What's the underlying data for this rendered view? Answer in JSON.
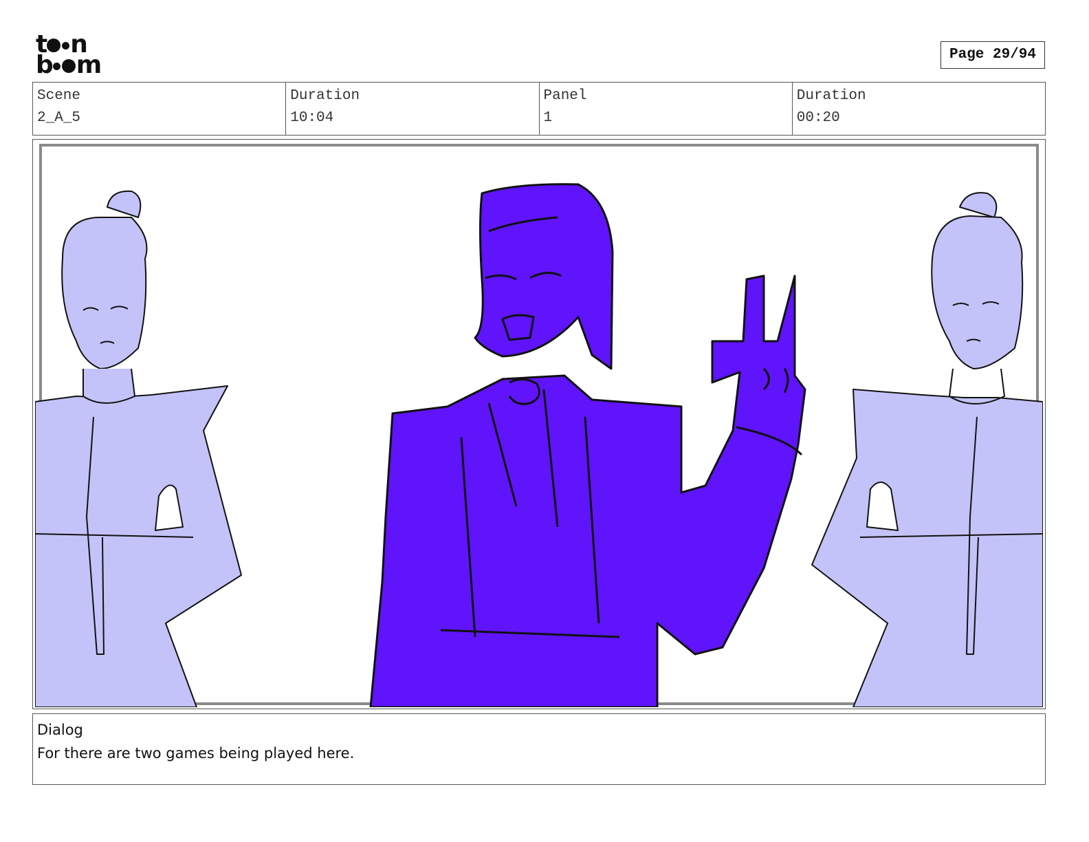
{
  "logo": {
    "line1": "t",
    "line1b": "n",
    "line2": "b",
    "line2b": "m"
  },
  "page": {
    "label": "Page 29/94"
  },
  "info": {
    "scene_label": "Scene",
    "scene_value": "2_A_5",
    "duration_label": "Duration",
    "duration_value": "10:04",
    "panel_label": "Panel",
    "panel_value": "1",
    "panel_duration_label": "Duration",
    "panel_duration_value": "00:20"
  },
  "dialog": {
    "label": "Dialog",
    "text": "For there are two games being played here."
  },
  "colors": {
    "main_figure": "#5f14fb",
    "side_figures": "#c3c3f9",
    "line_art": "#111111",
    "frame_border": "#8a8a8a"
  }
}
